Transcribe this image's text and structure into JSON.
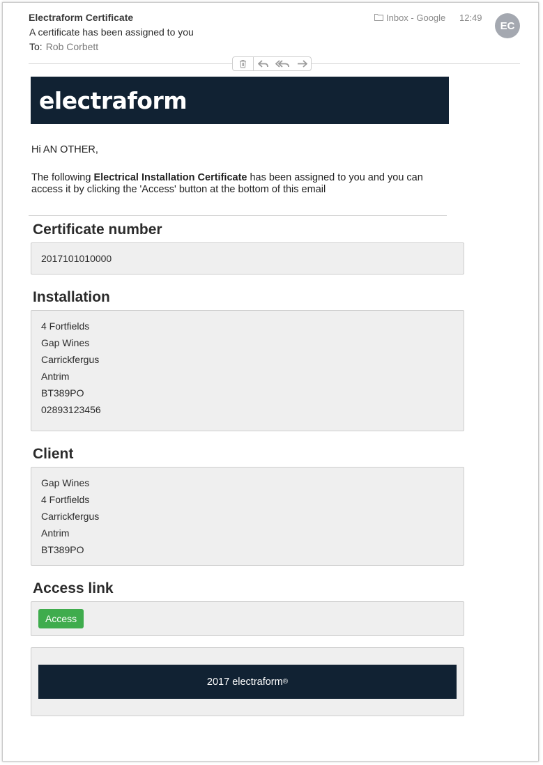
{
  "header": {
    "subject": "Electraform Certificate",
    "preview": "A certificate has been assigned to you",
    "to_label": "To:",
    "to_name": "Rob Corbett",
    "mailbox": "Inbox - Google",
    "time": "12:49",
    "avatar_initials": "EC"
  },
  "toolbar": {
    "icons": [
      "trash-icon",
      "reply-icon",
      "reply-all-icon",
      "forward-icon"
    ]
  },
  "email": {
    "banner_logo": "electraform",
    "greeting": "Hi AN OTHER,",
    "intro_before": "The following ",
    "intro_bold": "Electrical Installation Certificate",
    "intro_after": " has been assigned to you and you can access it by clicking the 'Access' button at the bottom of this email",
    "certificate": {
      "title": "Certificate number",
      "value": "2017101010000"
    },
    "installation": {
      "title": "Installation",
      "lines": [
        "4 Fortfields",
        "Gap Wines",
        "Carrickfergus",
        "Antrim",
        "BT389PO",
        "02893123456"
      ]
    },
    "client": {
      "title": "Client",
      "lines": [
        "Gap Wines",
        "4 Fortfields",
        "Carrickfergus",
        "Antrim",
        "BT389PO"
      ]
    },
    "access": {
      "title": "Access link",
      "button_label": "Access"
    },
    "footer": {
      "text": "2017 electraform",
      "mark": "®"
    }
  },
  "colors": {
    "banner_bg": "#112233",
    "access_button": "#3fac4d",
    "panel_bg": "#efefef"
  }
}
